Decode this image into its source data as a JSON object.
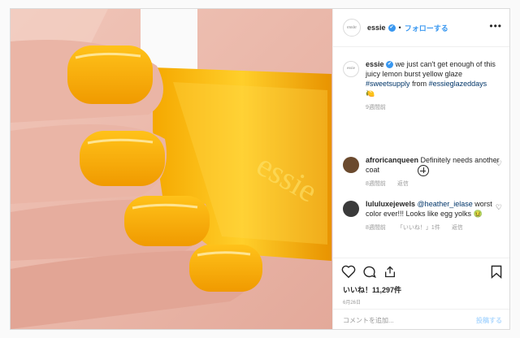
{
  "header": {
    "avatar_text": "essie",
    "username": "essie",
    "verified": "✔",
    "follow_label": "フォローする",
    "more_icon": "more-horizontal-icon"
  },
  "caption": {
    "username": "essie",
    "text": "we just can't get enough of this juicy lemon burst yellow glaze",
    "hashtag1": "#sweetsupply",
    "from": "from",
    "hashtag2": "#essieglazeddays",
    "emoji": "🍋",
    "time": "9週間前"
  },
  "comments": [
    {
      "username": "afroricanqueen",
      "text": "Definitely needs another coat",
      "time": "8週間前",
      "reply": "返信",
      "avatar_color": "#6b4a2e"
    },
    {
      "username": "lululuxejewels",
      "mention": "@heather_ielase",
      "text": "worst color ever!!! Looks like egg yolks",
      "emoji": "🤢",
      "time": "8週間前",
      "likes": "「いいね！」1件",
      "reply": "返信",
      "avatar_color": "#3a3a3a"
    }
  ],
  "actions": {
    "likes_label": "いいね！11,297件",
    "date": "6月26日",
    "add_comment_placeholder": "コメントを追加...",
    "post_label": "投稿する"
  },
  "colors": {
    "brand_blue": "#3897f0",
    "polish": "#f4b400"
  }
}
